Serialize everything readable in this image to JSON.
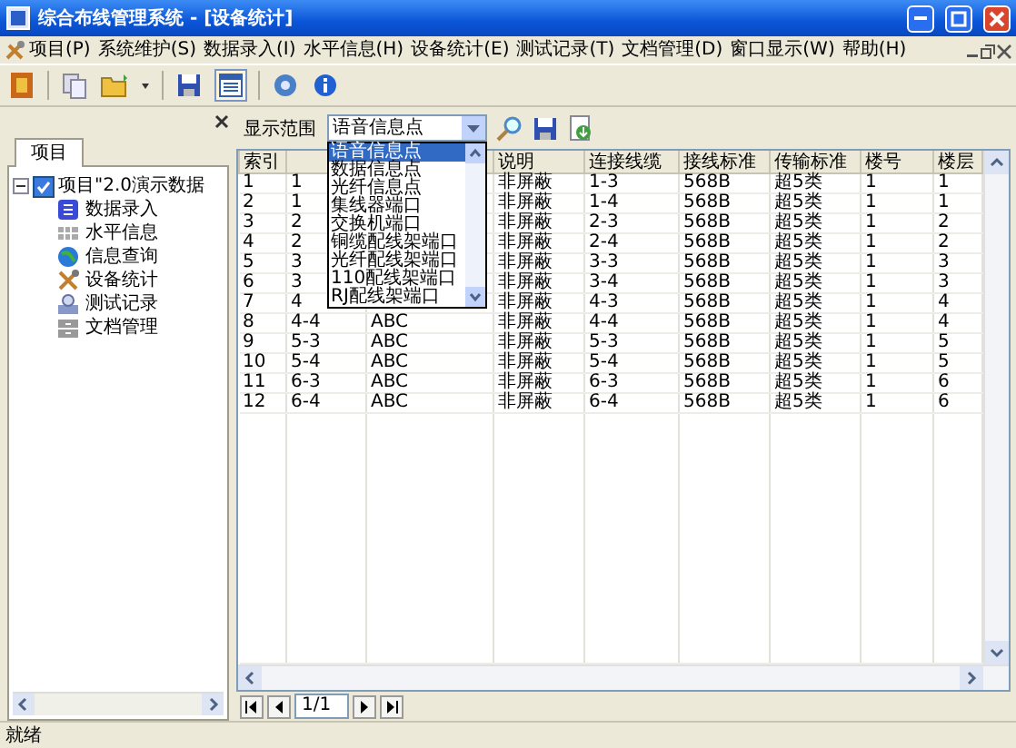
{
  "window": {
    "title": "综合布线管理系统 - [设备统计]"
  },
  "menu": [
    "项目(P)",
    "系统维护(S)",
    "数据录入(I)",
    "水平信息(H)",
    "设备统计(E)",
    "测试记录(T)",
    "文档管理(D)",
    "窗口显示(W)",
    "帮助(H)"
  ],
  "sidebar": {
    "tabs": [
      {
        "label": "项目",
        "selected": true
      }
    ],
    "tree": [
      {
        "label": "项目\"2.0演示数据",
        "expanded": true,
        "checked": true,
        "children": [
          {
            "label": "数据录入"
          },
          {
            "label": "水平信息"
          },
          {
            "label": "信息查询"
          },
          {
            "label": "设备统计"
          },
          {
            "label": "测试记录"
          },
          {
            "label": "文档管理"
          }
        ]
      }
    ]
  },
  "filter": {
    "label": "显示范围",
    "value": "语音信息点",
    "expanded": true,
    "options": [
      {
        "label": "语音信息点",
        "selected": true
      },
      {
        "label": "数据信息点",
        "selected": false
      },
      {
        "label": "光纤信息点",
        "selected": false
      },
      {
        "label": "集线器端口",
        "selected": false
      },
      {
        "label": "交换机端口",
        "selected": false
      },
      {
        "label": "铜缆配线架端口",
        "selected": false
      },
      {
        "label": "光纤配线架端口",
        "selected": false
      },
      {
        "label": "110配线架端口",
        "selected": false
      },
      {
        "label": "RJ配线架端口",
        "selected": false
      }
    ]
  },
  "table": {
    "columns": [
      "索引",
      null,
      null,
      "说明",
      "连接线缆",
      "接线标准",
      "传输标准",
      "楼号",
      "楼层"
    ],
    "rows": [
      [
        "1",
        "1",
        null,
        "非屏蔽",
        "1-3",
        "568B",
        "超5类",
        "1",
        "1"
      ],
      [
        "2",
        "1",
        null,
        "非屏蔽",
        "1-4",
        "568B",
        "超5类",
        "1",
        "1"
      ],
      [
        "3",
        "2",
        null,
        "非屏蔽",
        "2-3",
        "568B",
        "超5类",
        "1",
        "2"
      ],
      [
        "4",
        "2",
        null,
        "非屏蔽",
        "2-4",
        "568B",
        "超5类",
        "1",
        "2"
      ],
      [
        "5",
        "3",
        null,
        "非屏蔽",
        "3-3",
        "568B",
        "超5类",
        "1",
        "3"
      ],
      [
        "6",
        "3",
        null,
        "非屏蔽",
        "3-4",
        "568B",
        "超5类",
        "1",
        "3"
      ],
      [
        "7",
        "4",
        null,
        "非屏蔽",
        "4-3",
        "568B",
        "超5类",
        "1",
        "4"
      ],
      [
        "8",
        "4-4",
        "ABC",
        "非屏蔽",
        "4-4",
        "568B",
        "超5类",
        "1",
        "4"
      ],
      [
        "9",
        "5-3",
        "ABC",
        "非屏蔽",
        "5-3",
        "568B",
        "超5类",
        "1",
        "5"
      ],
      [
        "10",
        "5-4",
        "ABC",
        "非屏蔽",
        "5-4",
        "568B",
        "超5类",
        "1",
        "5"
      ],
      [
        "11",
        "6-3",
        "ABC",
        "非屏蔽",
        "6-3",
        "568B",
        "超5类",
        "1",
        "6"
      ],
      [
        "12",
        "6-4",
        "ABC",
        "非屏蔽",
        "6-4",
        "568B",
        "超5类",
        "1",
        "6"
      ]
    ]
  },
  "pager": {
    "page": "1/1"
  },
  "status_bar": "就绪"
}
